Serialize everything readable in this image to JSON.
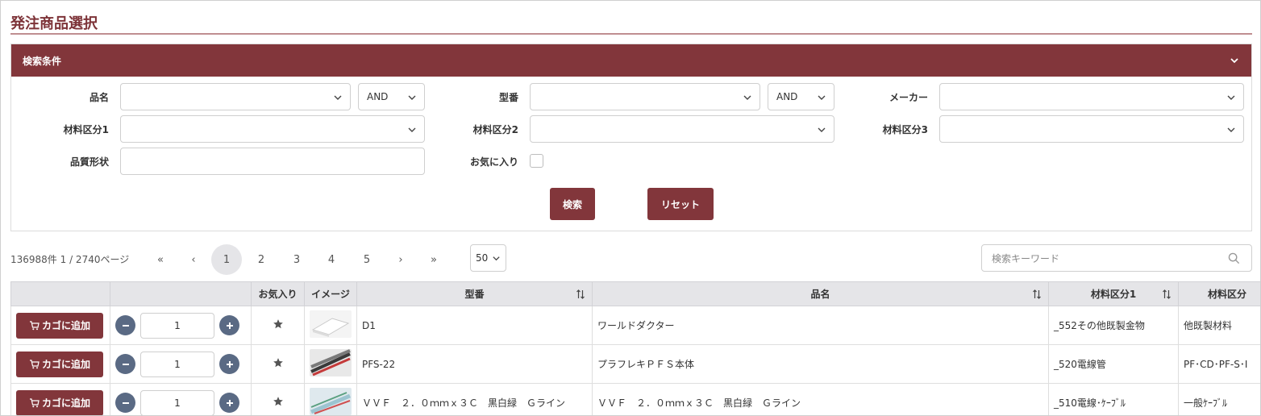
{
  "page": {
    "title": "発注商品選択"
  },
  "search": {
    "header": "検索条件",
    "labels": {
      "product_name": "品名",
      "model": "型番",
      "maker": "メーカー",
      "mat1": "材料区分1",
      "mat2": "材料区分2",
      "mat3": "材料区分3",
      "shape": "品質形状",
      "favorite": "お気に入り"
    },
    "values": {
      "product_name_op": "AND",
      "model_op": "AND"
    },
    "buttons": {
      "search": "検索",
      "reset": "リセット"
    }
  },
  "results": {
    "count_text": "136988件 1 / 2740ページ",
    "pager": [
      "«",
      "‹",
      "1",
      "2",
      "3",
      "4",
      "5",
      "›",
      "»"
    ],
    "per_page": "50",
    "keyword_placeholder": "検索キーワード"
  },
  "table": {
    "headers": [
      "",
      "",
      "お気入り",
      "イメージ",
      "型番",
      "品名",
      "材料区分1",
      "材料区分"
    ],
    "cart_label": "カゴに追加",
    "rows": [
      {
        "qty": "1",
        "model": "D1",
        "name": "ワールドダクター",
        "mat1": "_552その他既製金物",
        "mat2": "他既製材料"
      },
      {
        "qty": "1",
        "model": "PFS-22",
        "name": "プラフレキＰＦＳ本体",
        "mat1": "_520電線管",
        "mat2": "PF･CD･PF-S･I"
      },
      {
        "qty": "1",
        "model": "ＶＶＦ　２．０ｍｍｘ３Ｃ　黒白緑　Ｇライン",
        "name": "ＶＶＦ　２．０ｍｍｘ３Ｃ　黒白緑　Ｇライン",
        "mat1": "_510電線･ｹｰﾌﾞﾙ",
        "mat2": "一般ｹｰﾌﾞﾙ"
      }
    ]
  },
  "colors": {
    "brand": "#82363b",
    "header_bg": "#e5e5e8",
    "round_btn": "#5a6a84"
  }
}
